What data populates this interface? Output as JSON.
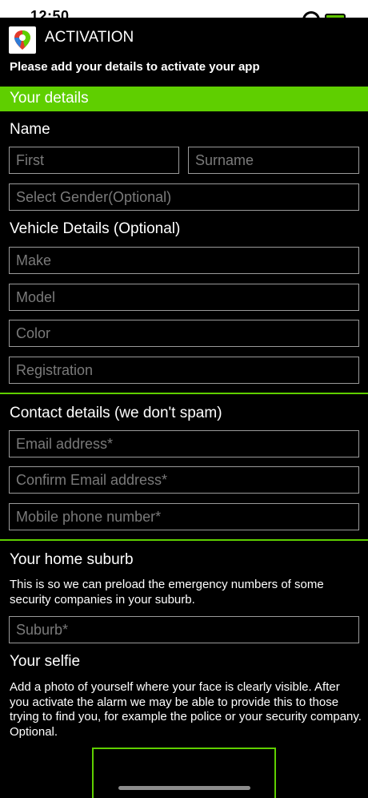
{
  "status": {
    "time": "12:50"
  },
  "header": {
    "title": "ACTIVATION"
  },
  "intro": "Please add your details to activate your app",
  "sections": {
    "your_details": "Your details",
    "name": "Name",
    "vehicle": "Vehicle Details (Optional)",
    "contact": "Contact details (we don't spam)",
    "suburb": "Your home suburb",
    "suburb_help": "This is so we can preload the emergency numbers of some security companies in your suburb.",
    "selfie": "Your selfie",
    "selfie_help": "Add a photo of yourself where your face is clearly visible. After you activate the alarm we may be able to provide this to those trying to find you, for example the police or your security company. Optional."
  },
  "fields": {
    "first": "First",
    "surname": "Surname",
    "gender": "Select Gender(Optional)",
    "make": "Make",
    "model": "Model",
    "color": "Color",
    "registration": "Registration",
    "email": "Email address*",
    "confirm_email": "Confirm Email address*",
    "mobile": "Mobile phone number*",
    "suburb": "Suburb*"
  },
  "colors": {
    "accent": "#5fcf00",
    "background": "#000000",
    "border": "#9a9a9a",
    "placeholder": "#7a7a7a"
  }
}
